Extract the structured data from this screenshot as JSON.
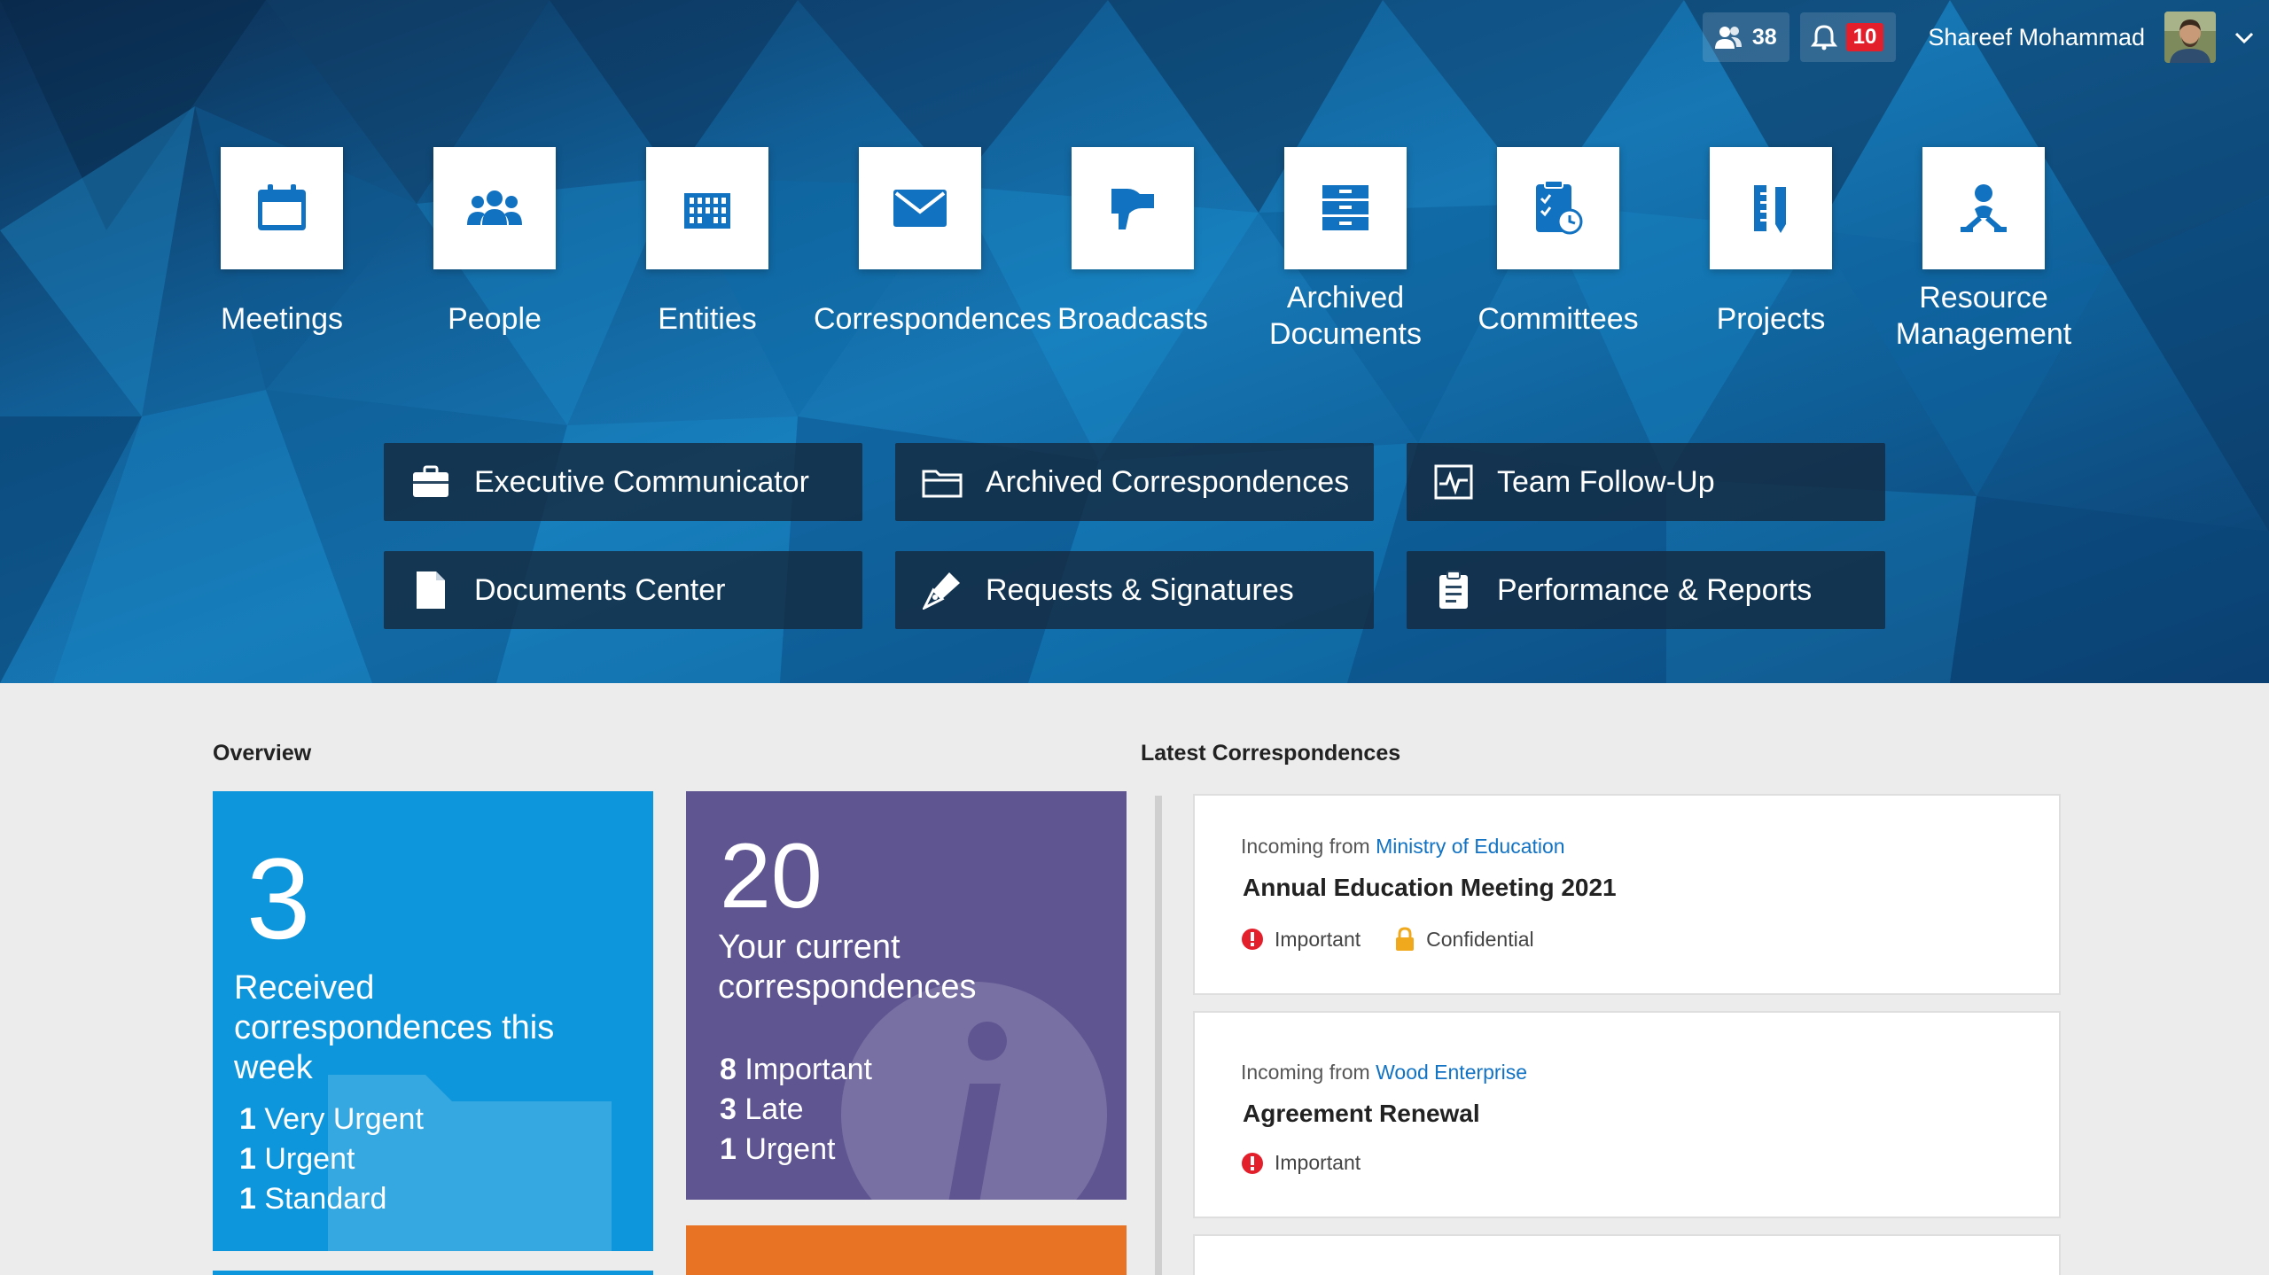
{
  "topbar": {
    "contacts_icon": "people-icon",
    "contacts_count": "38",
    "notifications_icon": "bell-icon",
    "notifications_count": "10",
    "user_name": "Shareef Mohammad",
    "menu_icon": "chevron-down-icon"
  },
  "modules": [
    {
      "label": "Meetings",
      "icon": "calendar-icon"
    },
    {
      "label": "People",
      "icon": "people-icon"
    },
    {
      "label": "Entities",
      "icon": "building-icon"
    },
    {
      "label": "Correspondences",
      "icon": "envelope-icon"
    },
    {
      "label": "Broadcasts",
      "icon": "megaphone-icon"
    },
    {
      "label": "Archived Documents",
      "icon": "archive-cabinet-icon"
    },
    {
      "label": "Committees",
      "icon": "clipboard-clock-icon"
    },
    {
      "label": "Projects",
      "icon": "ruler-pencil-icon"
    },
    {
      "label": "Resource Management",
      "icon": "person-network-icon"
    }
  ],
  "quick_links": [
    {
      "label": "Executive Communicator",
      "icon": "briefcase-icon"
    },
    {
      "label": "Archived Correspondences",
      "icon": "folder-icon"
    },
    {
      "label": "Team Follow-Up",
      "icon": "pulse-chart-icon"
    },
    {
      "label": "Documents Center",
      "icon": "document-icon"
    },
    {
      "label": "Requests & Signatures",
      "icon": "pen-nib-icon"
    },
    {
      "label": "Performance & Reports",
      "icon": "clipboard-report-icon"
    }
  ],
  "overview": {
    "title": "Overview",
    "received": {
      "count": "3",
      "label": "Received correspondences this week",
      "items": [
        {
          "n": "1",
          "label": "Very Urgent"
        },
        {
          "n": "1",
          "label": "Urgent"
        },
        {
          "n": "1",
          "label": "Standard"
        }
      ]
    },
    "current": {
      "count": "20",
      "label": "Your current correspondences",
      "items": [
        {
          "n": "8",
          "label": "Important"
        },
        {
          "n": "3",
          "label": "Late"
        },
        {
          "n": "1",
          "label": "Urgent"
        }
      ]
    }
  },
  "latest": {
    "title": "Latest Correspondences",
    "items": [
      {
        "prefix": "Incoming from",
        "source": "Ministry of Education",
        "title": "Annual Education Meeting 2021",
        "tags": [
          "Important",
          "Confidential"
        ]
      },
      {
        "prefix": "Incoming from",
        "source": "Wood Enterprise",
        "title": "Agreement Renewal",
        "tags": [
          "Important"
        ]
      }
    ]
  },
  "colors": {
    "accent_blue": "#0e96dc",
    "purple_card": "#5e5591",
    "orange_card": "#e97325",
    "important_red": "#e41f2c",
    "confidential_amber": "#f0a81c",
    "link_blue": "#1273c4"
  }
}
